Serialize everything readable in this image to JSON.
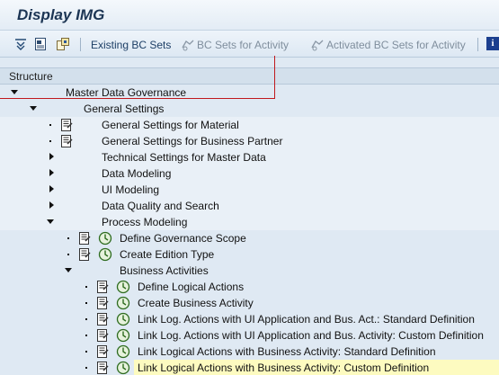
{
  "window": {
    "title": "Display IMG"
  },
  "toolbar": {
    "existing_bc_sets": "Existing BC Sets",
    "bc_sets_for_activity": "BC Sets for Activity",
    "activated_bc_sets_for_activity": "Activated BC Sets for Activity",
    "info_glyph": "i"
  },
  "tree": {
    "header": "Structure",
    "rows": [
      {
        "label": "Master Data Governance"
      },
      {
        "label": "General Settings"
      },
      {
        "label": "General Settings for Material"
      },
      {
        "label": "General Settings for Business Partner"
      },
      {
        "label": "Technical Settings for Master Data"
      },
      {
        "label": "Data Modeling"
      },
      {
        "label": "UI Modeling"
      },
      {
        "label": "Data Quality and Search"
      },
      {
        "label": "Process Modeling"
      },
      {
        "label": "Define Governance Scope"
      },
      {
        "label": "Create Edition Type"
      },
      {
        "label": "Business Activities"
      },
      {
        "label": "Define Logical Actions"
      },
      {
        "label": "Create Business Activity"
      },
      {
        "label": "Link Log. Actions with UI Application and Bus. Act.: Standard Definition"
      },
      {
        "label": "Link Log. Actions with UI Application and Bus. Activity: Custom Definition"
      },
      {
        "label": "Link Logical Actions with Business Activity: Standard Definition"
      },
      {
        "label": "Link Logical Actions with Business Activity: Custom Definition"
      }
    ]
  },
  "colors": {
    "highlight": "#fdfbc0",
    "marker": "#c0191d",
    "title": "#1c3554"
  }
}
